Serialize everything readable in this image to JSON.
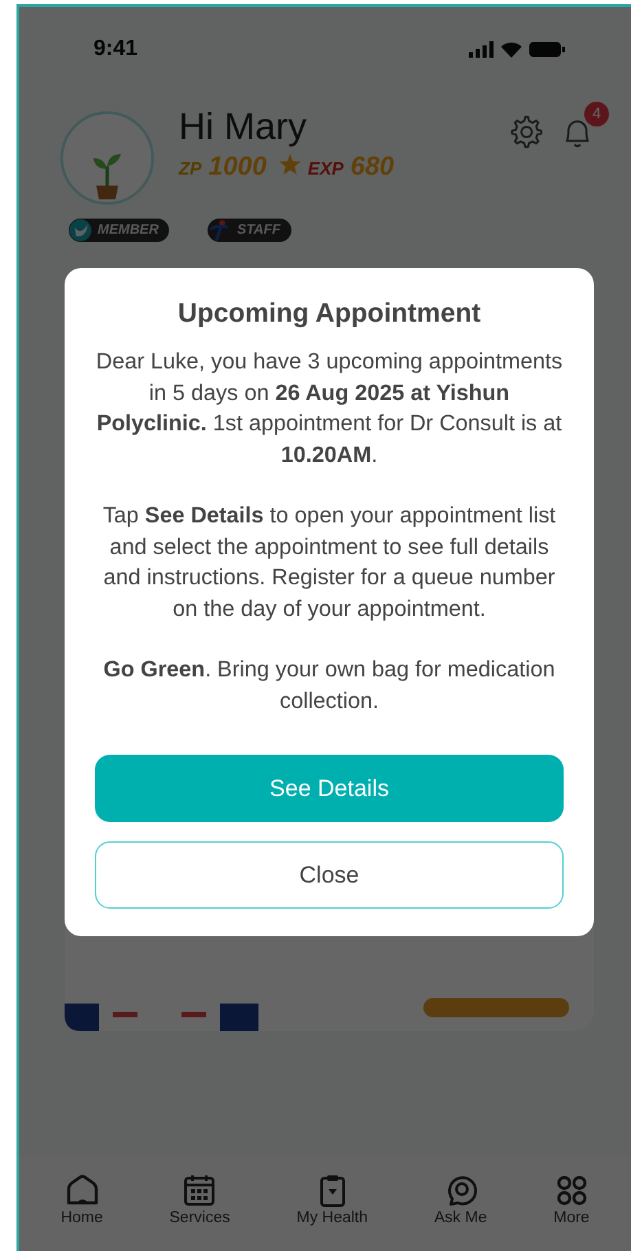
{
  "status_bar": {
    "time": "9:41"
  },
  "header": {
    "greeting": "Hi Mary",
    "notification_count": "4",
    "points": {
      "zp_label": "ZP",
      "zp_value": "1000",
      "exp_label": "EXP",
      "exp_value": "680"
    },
    "badges": [
      {
        "label": "MEMBER",
        "kind": "member"
      },
      {
        "label": "STAFF",
        "kind": "staff"
      }
    ]
  },
  "modal": {
    "title": "Upcoming Appointment",
    "paragraphs": [
      "Dear Luke, you have 3 upcoming appointments in 5 days on **26 Aug 2025 at Yishun Polyclinic.** 1st appointment for Dr Consult is at **10.20AM**.",
      "Tap **See Details** to open your appointment list and select the appointment to see full details and instructions. Register for a queue number on the day of your appointment.",
      "**Go Green**. Bring your own bag for medication collection."
    ],
    "buttons": [
      {
        "label": "See Details",
        "kind": "primary"
      },
      {
        "label": "Close",
        "kind": "secondary"
      }
    ]
  },
  "bottom_nav": [
    {
      "label": "Home",
      "kind": "home"
    },
    {
      "label": "Services",
      "kind": "calendar"
    },
    {
      "label": "My Health",
      "kind": "clipboard"
    },
    {
      "label": "Ask Me",
      "kind": "chat"
    },
    {
      "label": "More",
      "kind": "grid"
    }
  ]
}
